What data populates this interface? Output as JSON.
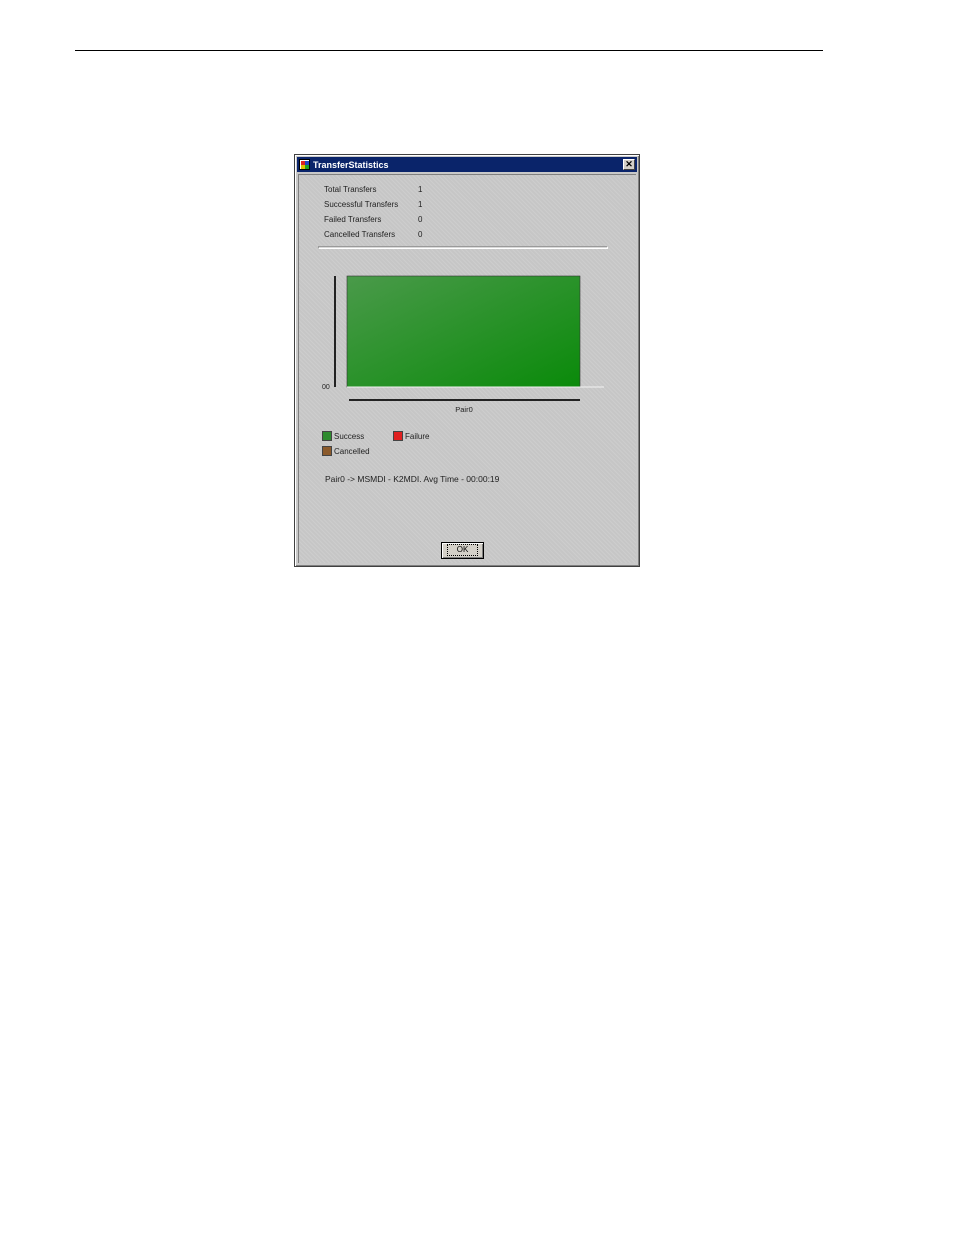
{
  "window": {
    "title": "TransferStatistics",
    "close_glyph": "✕"
  },
  "stats": [
    {
      "label": "Total Transfers",
      "value": "1"
    },
    {
      "label": "Successful Transfers",
      "value": "1"
    },
    {
      "label": "Failed Transfers",
      "value": "0"
    },
    {
      "label": "Cancelled Transfers",
      "value": "0"
    }
  ],
  "chart_data": {
    "type": "bar",
    "categories": [
      "Pair0"
    ],
    "series": [
      {
        "name": "Success",
        "values": [
          1
        ],
        "color": "#2e8b2e"
      },
      {
        "name": "Failure",
        "values": [
          0
        ],
        "color": "#e02020"
      },
      {
        "name": "Cancelled",
        "values": [
          0
        ],
        "color": "#8b5a2b"
      }
    ],
    "y_tick_labels": [
      "00"
    ],
    "ylim": [
      0,
      1
    ],
    "grid": false,
    "legend": "bottom-left"
  },
  "summary": "Pair0 -> MSMDI - K2MDI. Avg Time - 00:00:19",
  "buttons": {
    "ok_label": "OK"
  },
  "icons": {
    "app": "app-window-icon",
    "close": "close-icon"
  }
}
